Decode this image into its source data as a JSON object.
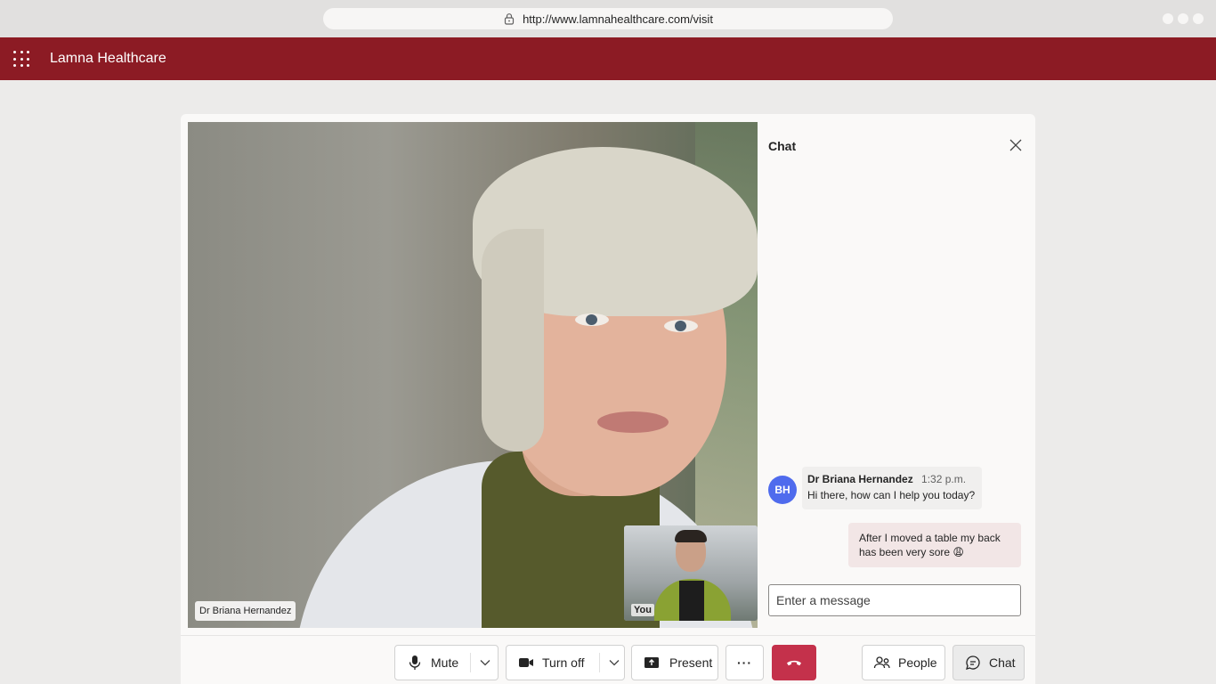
{
  "browser": {
    "url": "http://www.lamnahealthcare.com/visit"
  },
  "app": {
    "title": "Lamna Healthcare"
  },
  "video": {
    "main_participant": "Dr Briana Hernandez",
    "self_label": "You"
  },
  "chat": {
    "title": "Chat",
    "messages": [
      {
        "initials": "BH",
        "sender": "Dr Briana Hernandez",
        "time": "1:32 p.m.",
        "text": "Hi there, how can I help you today?"
      },
      {
        "text": "After I moved a table my back has been very sore 😩"
      }
    ],
    "input_placeholder": "Enter a message"
  },
  "controls": {
    "mute_label": "Mute",
    "video_label": "Turn off",
    "present_label": "Present",
    "more_label": "···",
    "people_label": "People",
    "chat_label": "Chat"
  },
  "colors": {
    "brand": "#8c1b24",
    "hangup": "#c4314b",
    "avatar": "#4f6bed",
    "self_bubble": "#f2e6e6"
  },
  "icons": [
    "lock-icon",
    "waffle-icon",
    "close-icon",
    "microphone-icon",
    "chevron-down-icon",
    "camera-icon",
    "share-screen-icon",
    "more-icon",
    "hang-up-icon",
    "people-icon",
    "chat-icon"
  ]
}
